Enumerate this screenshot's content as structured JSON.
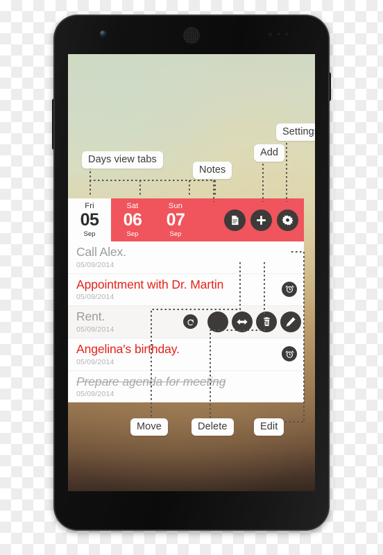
{
  "device": {
    "name": "smartphone-mockup",
    "hardware": [
      "front-camera",
      "earpiece-speaker",
      "proximity-sensor",
      "volume-rocker",
      "power-button"
    ]
  },
  "app": {
    "accent_red": "#f0545c",
    "task_red": "#e32219",
    "icon_dark": "#3d3a39",
    "panel_bg": "#fdfdfd",
    "daybar": {
      "tabs": [
        {
          "dow": "Fri",
          "num": "05",
          "mon": "Sep",
          "active": true
        },
        {
          "dow": "Sat",
          "num": "06",
          "mon": "Sep",
          "active": false
        },
        {
          "dow": "Sun",
          "num": "07",
          "mon": "Sep",
          "active": false
        }
      ],
      "actions": [
        {
          "name": "notes-icon",
          "label": "Notes"
        },
        {
          "name": "add-icon",
          "label": "Add"
        },
        {
          "name": "settings-gear-icon",
          "label": "Settings"
        }
      ]
    },
    "tasks": [
      {
        "title": "Call Alex.",
        "date": "05/09/2014",
        "style": "normal",
        "alarm": false,
        "swiped": false
      },
      {
        "title": "Appointment with Dr. Martin",
        "date": "05/09/2014",
        "style": "red",
        "alarm": true,
        "swiped": false
      },
      {
        "title": "Rent.",
        "date": "05/09/2014",
        "style": "normal",
        "alarm": false,
        "swiped": true
      },
      {
        "title": "Angelina's birthday.",
        "date": "05/09/2014",
        "style": "red",
        "alarm": true,
        "swiped": false
      },
      {
        "title": "Prepare agenda for meeting",
        "date": "05/09/2014",
        "style": "done",
        "alarm": false,
        "swiped": false
      }
    ],
    "swipe_actions": [
      {
        "name": "undo-icon",
        "label": "Undo"
      },
      {
        "name": "blank-circle-icon",
        "label": ""
      },
      {
        "name": "move-icon",
        "label": "Move"
      },
      {
        "name": "delete-trash-icon",
        "label": "Delete"
      },
      {
        "name": "edit-pencil-icon",
        "label": "Edit"
      }
    ]
  },
  "annotations": {
    "days_view_tabs": "Days view tabs",
    "notes": "Notes",
    "add": "Add",
    "settings": "Settings",
    "move": "Move",
    "delete": "Delete",
    "edit": "Edit"
  }
}
